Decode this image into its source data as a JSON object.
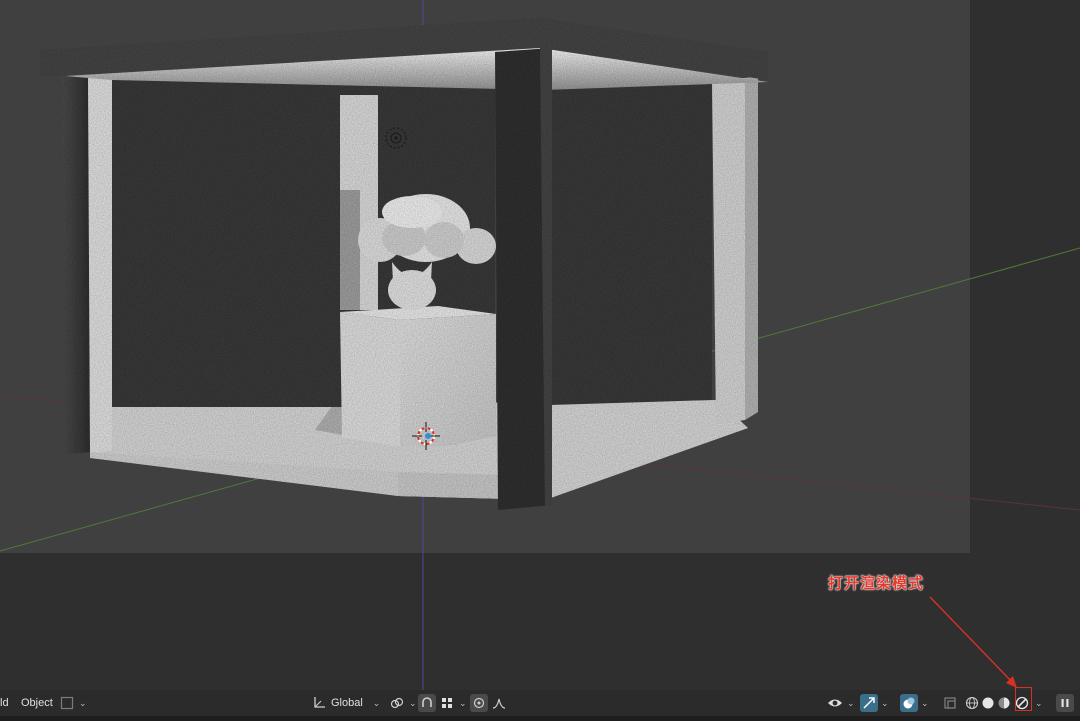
{
  "annotation": {
    "text": "打开渲染模式",
    "color": "#e23b2e"
  },
  "header": {
    "left": {
      "mode_fragment": "ld",
      "object_menu": "Object"
    },
    "center": {
      "orientation": "Global"
    },
    "right": {
      "shading_modes": [
        "wireframe",
        "solid",
        "material-preview",
        "rendered"
      ],
      "active_shading": "rendered"
    }
  },
  "colors": {
    "background": "#2f2f2f",
    "camera_frame": "#404040",
    "header": "#2b2b2b",
    "x_axis": "#8a3b3b",
    "y_axis": "#4f7a3a",
    "z_axis": "#4a4aa0",
    "highlight": "#d93026"
  },
  "icons": [
    "view-icon",
    "gizmo-icon",
    "overlay-icon",
    "xray-icon",
    "pivot-icon",
    "snap-icon",
    "proportional-icon",
    "transform-orientation-icon"
  ]
}
